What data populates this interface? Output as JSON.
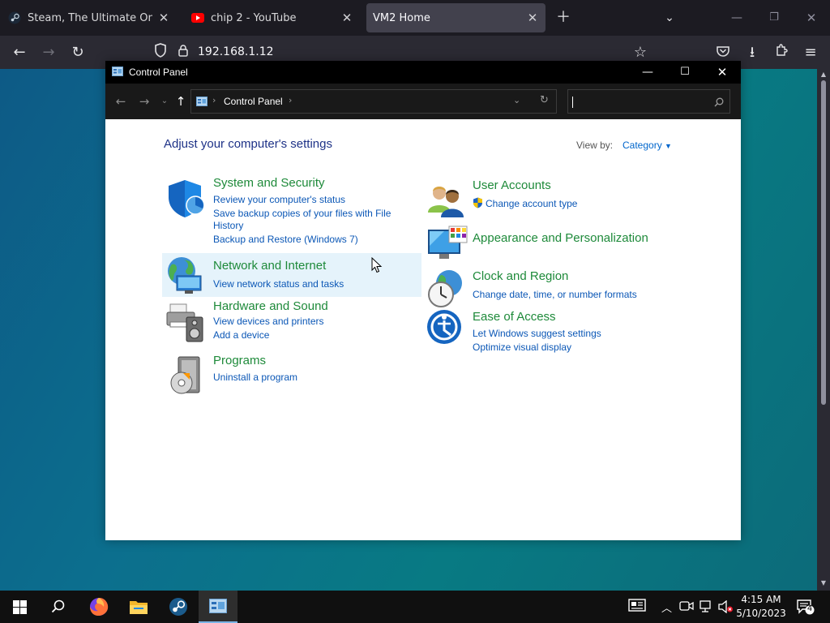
{
  "browser": {
    "tabs": [
      {
        "label": "Steam, The Ultimate Online Gam",
        "icon": "steam-icon"
      },
      {
        "label": "chip 2 - YouTube",
        "icon": "youtube-icon"
      },
      {
        "label": "VM2 Home",
        "icon": "",
        "active": true
      }
    ],
    "url": "192.168.1.12"
  },
  "window": {
    "title": "Control Panel",
    "breadcrumb": "Control Panel"
  },
  "controlpanel": {
    "heading": "Adjust your computer's settings",
    "view_by_label": "View by:",
    "view_by_value": "Category",
    "categories": [
      {
        "title": "System and Security",
        "icon": "shield-icon",
        "links": [
          "Review your computer's status",
          "Save backup copies of your files with File",
          "History",
          "Backup and Restore (Windows 7)"
        ]
      },
      {
        "title": "Network and Internet",
        "icon": "network-globe-icon",
        "links": [
          "View network status and tasks"
        ]
      },
      {
        "title": "Hardware and Sound",
        "icon": "printer-speaker-icon",
        "links": [
          "View devices and printers",
          "Add a device"
        ]
      },
      {
        "title": "Programs",
        "icon": "programs-disk-icon",
        "links": [
          "Uninstall a program"
        ]
      },
      {
        "title": "User Accounts",
        "icon": "users-icon",
        "links": [
          "Change account type"
        ]
      },
      {
        "title": "Appearance and Personalization",
        "icon": "monitor-palette-icon",
        "links": []
      },
      {
        "title": "Clock and Region",
        "icon": "globe-clock-icon",
        "links": [
          "Change date, time, or number formats"
        ]
      },
      {
        "title": "Ease of Access",
        "icon": "ease-of-access-icon",
        "links": [
          "Let Windows suggest settings",
          "Optimize visual display"
        ]
      }
    ]
  },
  "taskbar": {
    "time": "4:15 AM",
    "date": "5/10/2023",
    "notifications": "4"
  },
  "colors": {
    "accent": "#0b57b6",
    "category_title": "#1e8a3a",
    "hover_bg": "#e5f3fb"
  }
}
